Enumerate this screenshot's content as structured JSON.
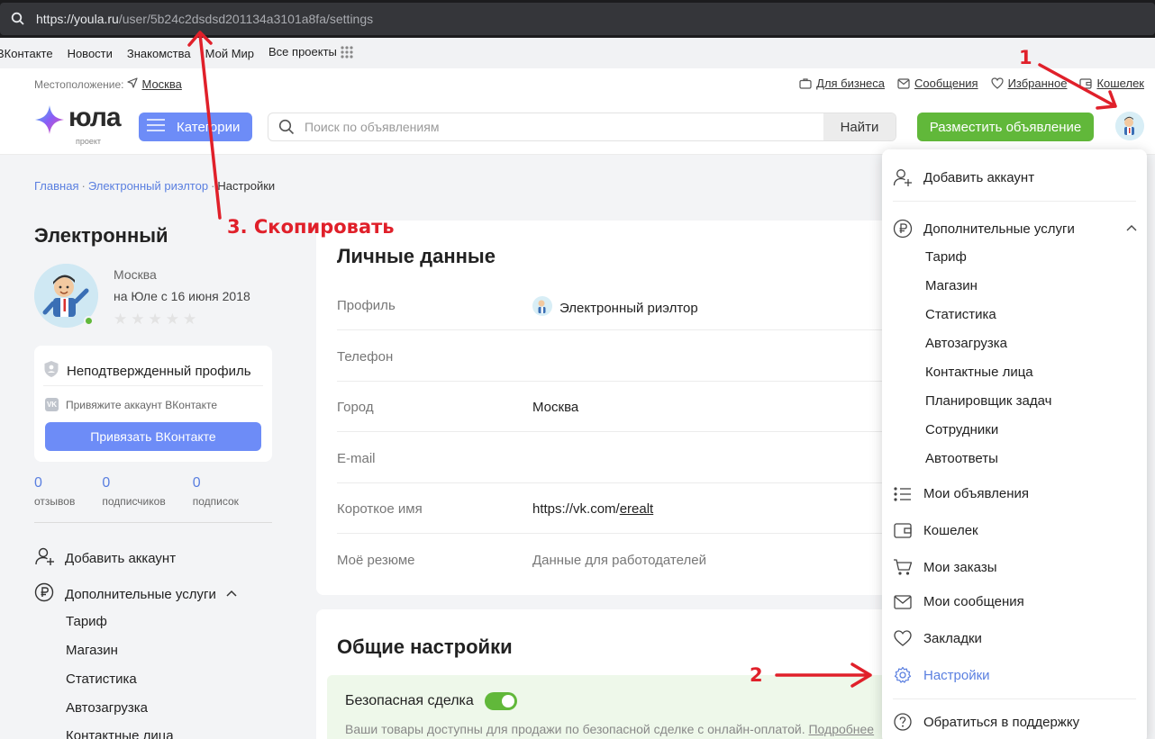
{
  "browser": {
    "url_host": "https://youla.ru",
    "url_path": "/user/5b24c2dsdsd201134a3101a8fa/settings"
  },
  "bookmarks": [
    "ВКонтакте",
    "Новости",
    "Знакомства",
    "Мой Мир",
    "Все проекты"
  ],
  "header": {
    "location_label": "Местоположение:",
    "location_city": "Москва",
    "toplinks": [
      "Для бизнеса",
      "Сообщения",
      "Избранное",
      "Кошелек"
    ],
    "logo_text": "юла",
    "logo_sub": "проект",
    "categories_label": "Категории",
    "search_placeholder": "Поиск по объявлениям",
    "search_button": "Найти",
    "post_button": "Разместить объявление"
  },
  "breadcrumb": {
    "items": [
      "Главная",
      "Электронный риэлтор",
      "Настройки"
    ],
    "separator": "·"
  },
  "profile": {
    "name": "Электронный",
    "city": "Москва",
    "since": "на Юле с 16 июня 2018",
    "rating_stars": 0,
    "verify_title": "Неподтвержденный профиль",
    "vk_text": "Привяжите аккаунт ВКонтакте",
    "vk_badge": "VK",
    "vk_button": "Привязать ВКонтакте",
    "counters": [
      {
        "value": "0",
        "label": "отзывов"
      },
      {
        "value": "0",
        "label": "подписчиков"
      },
      {
        "value": "0",
        "label": "подписок"
      }
    ],
    "menu": {
      "add_account": "Добавить аккаунт",
      "extra_services": "Дополнительные услуги",
      "sub": [
        "Тариф",
        "Магазин",
        "Статистика",
        "Автозагрузка",
        "Контактные лица"
      ]
    }
  },
  "personal": {
    "title": "Личные данные",
    "rows": [
      {
        "label": "Профиль",
        "value": "Электронный риэлтор"
      },
      {
        "label": "Телефон",
        "value": ""
      },
      {
        "label": "Город",
        "value": "Москва"
      },
      {
        "label": "E-mail",
        "value": ""
      },
      {
        "label": "Короткое имя",
        "value_prefix": "https://vk.com/",
        "value_link": "erealt"
      },
      {
        "label": "Моё резюме",
        "value": "Данные для работодателей"
      }
    ]
  },
  "general": {
    "title": "Общие настройки",
    "safe_deal_title": "Безопасная сделка",
    "safe_deal_enabled": true,
    "safe_deal_desc": "Ваши товары доступны для продажи по безопасной сделке с онлайн-оплатой.",
    "safe_deal_more": "Подробнее"
  },
  "dropdown": {
    "add_account": "Добавить аккаунт",
    "extra_services": "Дополнительные услуги",
    "sub": [
      "Тариф",
      "Магазин",
      "Статистика",
      "Автозагрузка",
      "Контактные лица",
      "Планировщик задач",
      "Сотрудники",
      "Автоответы"
    ],
    "items": [
      "Мои объявления",
      "Кошелек",
      "Мои заказы",
      "Мои сообщения",
      "Закладки",
      "Настройки"
    ],
    "support": "Обратиться в поддержку"
  },
  "annotations": {
    "step1": "1",
    "step2": "2",
    "step3": "3. Скопировать",
    "color": "#e0202a"
  },
  "colors": {
    "accent_blue": "#6d8cf7",
    "accent_green": "#61b83a",
    "link_blue": "#5a7fe0"
  }
}
